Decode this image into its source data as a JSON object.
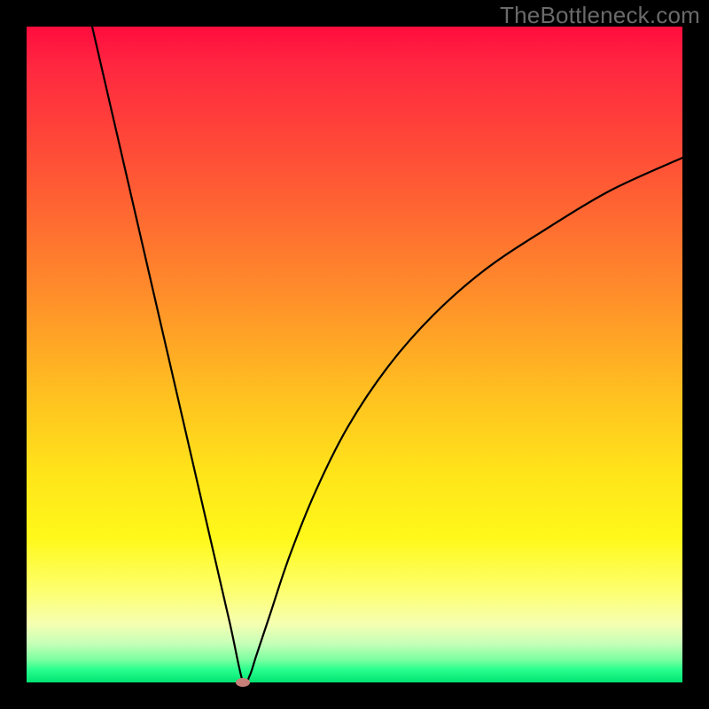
{
  "watermark": "TheBottleneck.com",
  "colors": {
    "frame": "#000000",
    "curve": "#000000",
    "marker": "#c68079",
    "gradient_stops": [
      "#ff0c3e",
      "#ff2740",
      "#ff5a34",
      "#ff8b2b",
      "#ffbd21",
      "#ffe41a",
      "#fff81a",
      "#fdff6e",
      "#f6ffb0",
      "#c7ffb8",
      "#7effa1",
      "#2bff8e",
      "#00e371"
    ]
  },
  "chart_data": {
    "type": "line",
    "title": "",
    "xlabel": "",
    "ylabel": "",
    "xlim": [
      0,
      100
    ],
    "ylim": [
      0,
      100
    ],
    "grid": false,
    "notes": "V-shaped bottleneck curve. Minimum (optimal match) at x≈33, y≈0. Left branch rises steeply and exits top near x≈10. Right branch rises more gradually, concave, reaching y≈80 at x=100. No axis ticks or labels visible.",
    "series": [
      {
        "name": "bottleneck-curve",
        "x": [
          10,
          13,
          16,
          19,
          22,
          25,
          28,
          31,
          33,
          34,
          35,
          37,
          40,
          44,
          49,
          55,
          62,
          70,
          79,
          89,
          100
        ],
        "y": [
          100,
          87,
          74,
          61,
          48,
          35,
          22,
          9,
          0,
          1,
          4,
          10,
          19,
          29,
          39,
          48,
          56,
          63,
          69,
          75,
          80
        ]
      }
    ],
    "marker": {
      "x": 33,
      "y": 0,
      "label": "optimal-point"
    }
  }
}
